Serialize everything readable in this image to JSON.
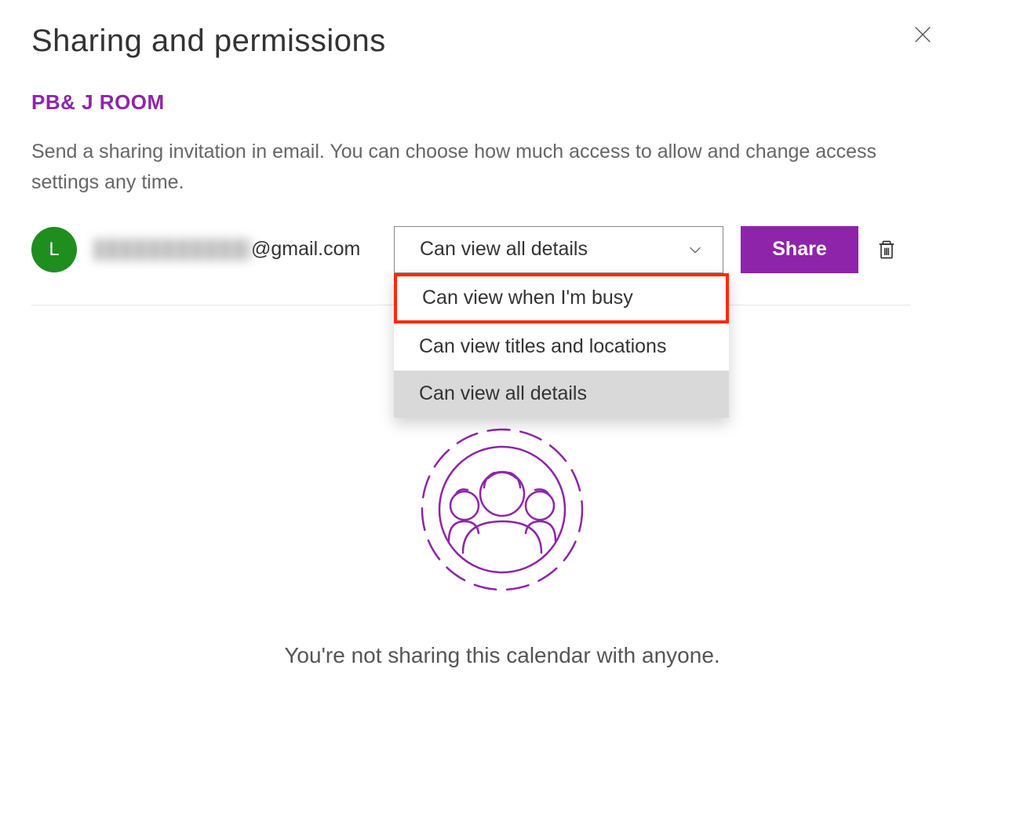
{
  "header": {
    "title": "Sharing and permissions"
  },
  "calendar": {
    "name": "PB& J ROOM",
    "description": "Send a sharing invitation in email. You can choose how much access to allow and change access settings any time."
  },
  "invite": {
    "avatar_initial": "L",
    "email_domain": "@gmail.com",
    "permission_selected": "Can view all details",
    "permission_options": [
      "Can view when I'm busy",
      "Can view titles and locations",
      "Can view all details"
    ],
    "share_button_label": "Share"
  },
  "empty_state": {
    "message": "You're not sharing this calendar with anyone."
  },
  "colors": {
    "accent": "#8E24AA",
    "avatar": "#1E8E1E",
    "highlight_border": "#ff2a00"
  }
}
